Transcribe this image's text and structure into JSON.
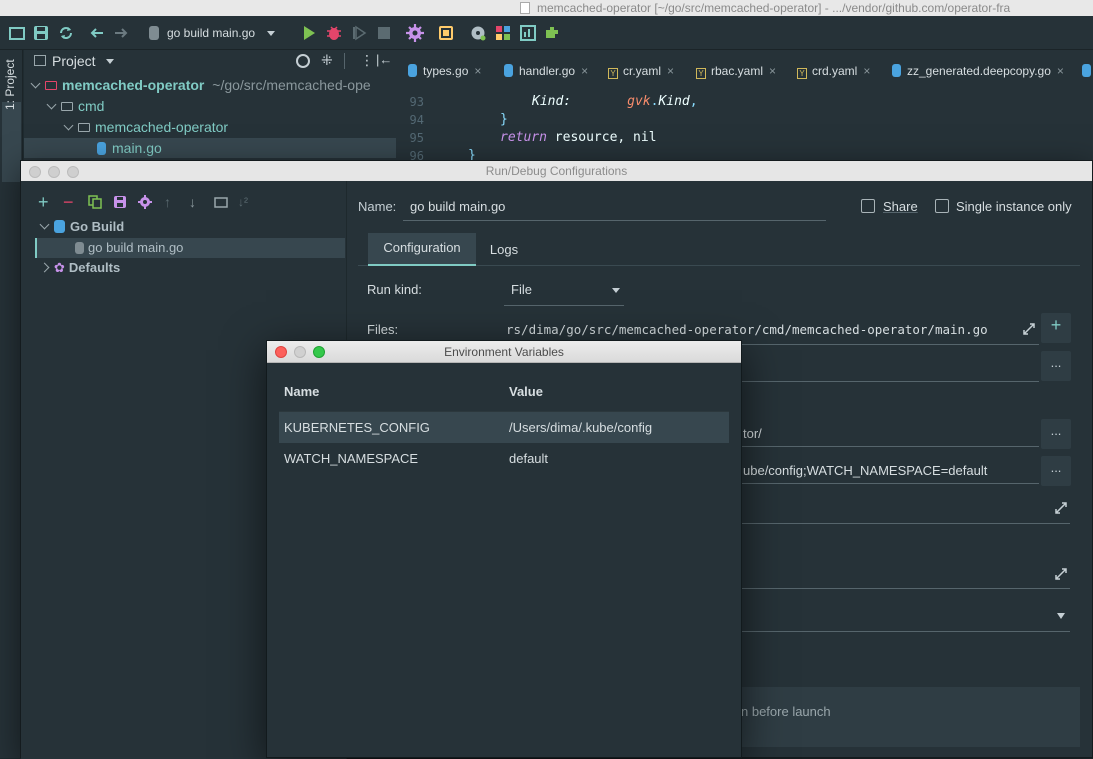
{
  "os_window": {
    "title": "memcached-operator [~/go/src/memcached-operator] - .../vendor/github.com/operator-fra"
  },
  "toolbar": {
    "run_config_label": "go build main.go",
    "icons": [
      "folder-icon",
      "save-icon",
      "sync-icon",
      "back-icon",
      "forward-icon",
      "run-icon",
      "debug-icon",
      "coverage-icon",
      "stop-icon",
      "settings-icon",
      "sdk-icon",
      "record-icon",
      "structure-icon",
      "terminal-icon",
      "plugin-icon"
    ]
  },
  "sidebar_strip": {
    "project_label": "1: Project"
  },
  "project": {
    "header_label": "Project",
    "tree": [
      {
        "label": "memcached-operator",
        "suffix": "~/go/src/memcached-ope"
      },
      {
        "label": "cmd"
      },
      {
        "label": "memcached-operator"
      },
      {
        "label": "main.go"
      }
    ]
  },
  "editor": {
    "tabs": [
      {
        "label": "types.go",
        "kind": "go"
      },
      {
        "label": "handler.go",
        "kind": "go"
      },
      {
        "label": "cr.yaml",
        "kind": "yaml"
      },
      {
        "label": "rbac.yaml",
        "kind": "yaml"
      },
      {
        "label": "crd.yaml",
        "kind": "yaml"
      },
      {
        "label": "zz_generated.deepcopy.go",
        "kind": "go"
      }
    ],
    "lines": [
      {
        "no": "93",
        "kw": "Kind:",
        "val": "gvk",
        "sep": ".",
        "field": "Kind",
        "end": ","
      },
      {
        "no": "94",
        "text": "}"
      },
      {
        "no": "95",
        "kw": "return",
        "rest": " resource, nil"
      },
      {
        "no": "96",
        "text": "}"
      }
    ]
  },
  "run_dialog": {
    "title": "Run/Debug Configurations",
    "tree": {
      "group_label": "Go Build",
      "item_label": "go build main.go",
      "defaults_label": "Defaults"
    },
    "name_label": "Name:",
    "name_value": "go build main.go",
    "share_label": "Share",
    "single_instance_label": "Single instance only",
    "tabs": [
      "Configuration",
      "Logs"
    ],
    "run_kind_label": "Run kind:",
    "run_kind_value": "File",
    "files_label": "Files:",
    "files_value": "rs/dima/go/src/memcached-operator/cmd/memcached-operator/main.go",
    "working_dir_value": "tor/",
    "env_value": "ube/config;WATCH_NAMESPACE=default",
    "before_launch_text": "n before launch",
    "add_button": "+",
    "browse_button": "..."
  },
  "env_dialog": {
    "title": "Environment Variables",
    "columns": [
      "Name",
      "Value"
    ],
    "rows": [
      {
        "name": "KUBERNETES_CONFIG",
        "value": "/Users/dima/.kube/config"
      },
      {
        "name": "WATCH_NAMESPACE",
        "value": "default"
      }
    ]
  },
  "colors": {
    "accent": "#80cbc4",
    "selection": "#37474f",
    "background": "#263238",
    "keyword": "#c792ea",
    "orange": "#f78c6c"
  }
}
